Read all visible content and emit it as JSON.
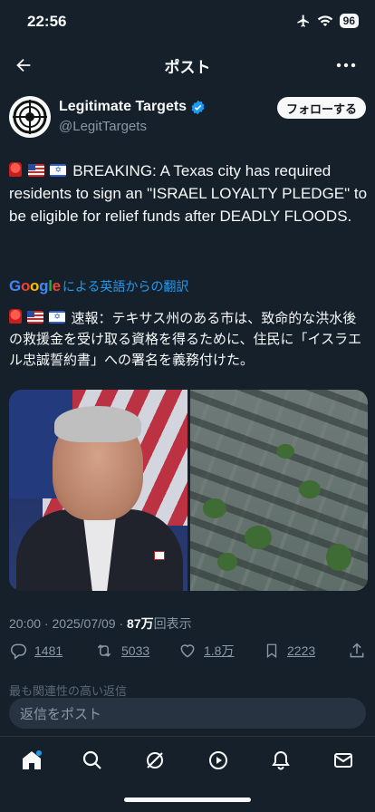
{
  "status_bar": {
    "time": "22:56",
    "battery": "96"
  },
  "header": {
    "title": "ポスト"
  },
  "author": {
    "name": "Legitimate Targets",
    "handle": "@LegitTargets",
    "verified": true
  },
  "follow_button": {
    "label": "フォローする"
  },
  "tweet": {
    "text": "BREAKING: A Texas city has required residents to sign an \"ISRAEL LOYALTY PLEDGE\" to be eligible for relief funds after DEADLY FLOODS."
  },
  "translation": {
    "logo": "Google",
    "label": "による英語からの翻訳",
    "text": "速報：テキサス州のある市は、致命的な洪水後の救援金を受け取る資格を得るために、住民に「イスラエル忠誠誓約書」への署名を義務付けた。"
  },
  "meta": {
    "time": "20:00",
    "separator": " · ",
    "date": "2025/07/09",
    "views": "87万",
    "views_label": "回表示"
  },
  "actions": {
    "replies": "1481",
    "reposts": "5033",
    "likes": "1.8万",
    "bookmarks": "2223"
  },
  "faded_text": "最も関連性の高い返信",
  "reply_bar": {
    "placeholder": "返信をポスト"
  },
  "colors": {
    "background": "#15202b",
    "accent": "#1d9bf0",
    "verified": "#1d9bf0",
    "muted": "#8b98a5"
  },
  "icons": [
    "back-icon",
    "more-icon",
    "verified-icon",
    "reply-icon",
    "repost-icon",
    "like-icon",
    "bookmark-icon",
    "share-icon",
    "home-icon",
    "search-icon",
    "grok-icon",
    "video-icon",
    "notifications-icon",
    "messages-icon"
  ]
}
